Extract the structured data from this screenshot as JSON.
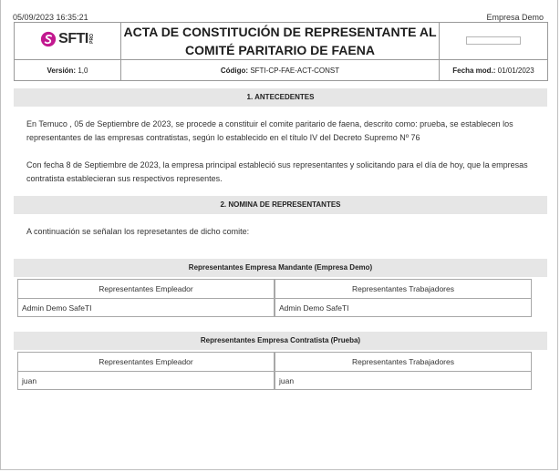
{
  "header": {
    "timestamp": "05/09/2023 16:35:21",
    "company": "Empresa Demo",
    "logo_text": "SFTI",
    "logo_sub": "PRO",
    "title_line1": "ACTA DE CONSTITUCIÓN DE REPRESENTANTE AL",
    "title_line2": "COMITÉ PARITARIO DE FAENA",
    "version_label": "Versión:",
    "version_value": "1,0",
    "code_label": "Código:",
    "code_value": "SFTI-CP-FAE-ACT-CONST",
    "date_label": "Fecha mod.:",
    "date_value": "01/01/2023"
  },
  "section1": {
    "title": "1. ANTECEDENTES",
    "para1": "En Temuco , 05 de Septiembre de 2023, se procede a constituir el comite paritario de faena, descrito como: prueba, se establecen los representantes de las empresas contratistas, según lo establecido en el título IV del Decreto Supremo Nº 76",
    "para2": "Con fecha 8 de Septiembre de 2023, la empresa principal estableció sus representantes y solicitando para el día de hoy, que la empresas contratista establecieran sus respectivos representes."
  },
  "section2": {
    "title": "2. NOMINA DE REPRESENTANTES",
    "intro": "A continuación se señalan los represetantes de dicho comite:",
    "groups": [
      {
        "title": "Representantes Empresa Mandante (Empresa Demo)",
        "employer_label": "Representantes Empleador",
        "employer_name": "Admin Demo SafeTI",
        "workers_label": "Representantes Trabajadores",
        "workers_name": "Admin Demo SafeTI"
      },
      {
        "title": "Representantes Empresa Contratista (Prueba)",
        "employer_label": "Representantes Empleador",
        "employer_name": "juan",
        "workers_label": "Representantes Trabajadores",
        "workers_name": "juan"
      }
    ]
  },
  "colors": {
    "band": "#e6e6e6",
    "logo_magenta": "#c2188f"
  }
}
